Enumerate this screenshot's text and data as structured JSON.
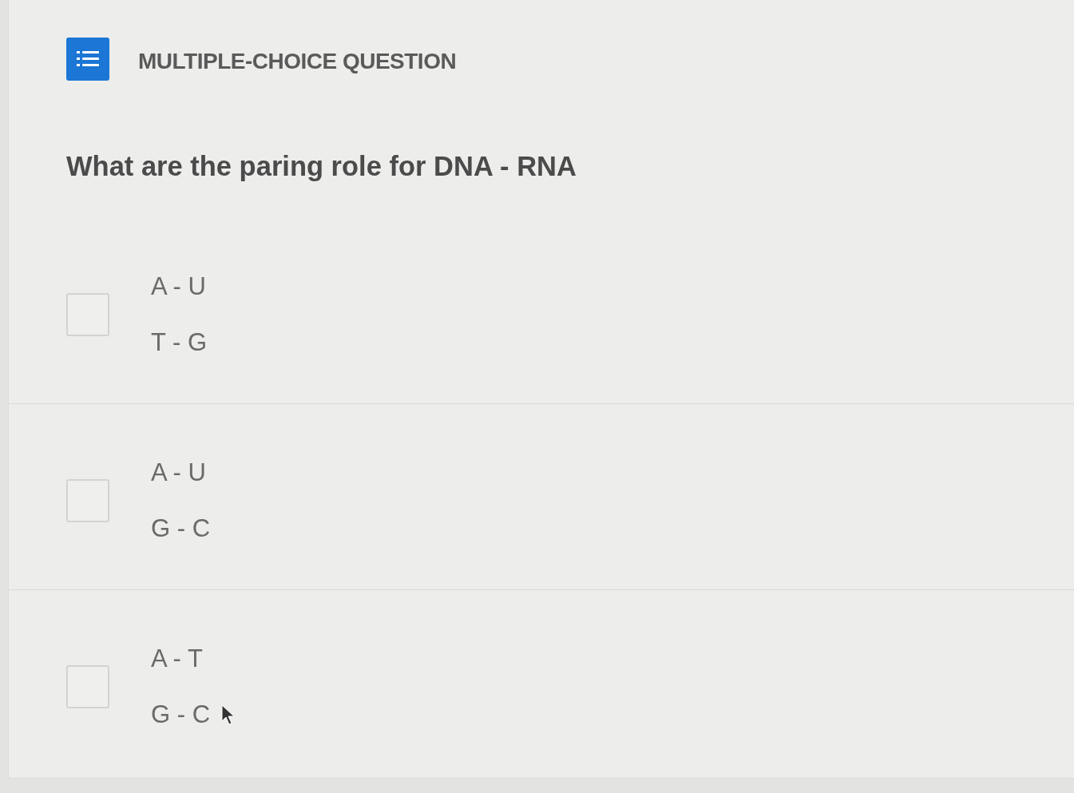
{
  "header": {
    "title": "MULTIPLE-CHOICE QUESTION"
  },
  "question": "What are the paring role for DNA - RNA",
  "options": [
    {
      "lines": [
        "A - U",
        "T - G"
      ],
      "checked": false,
      "hovered": false
    },
    {
      "lines": [
        "A - U",
        "G - C"
      ],
      "checked": false,
      "hovered": false
    },
    {
      "lines": [
        "A - T",
        "G - C"
      ],
      "checked": false,
      "hovered": true
    }
  ]
}
